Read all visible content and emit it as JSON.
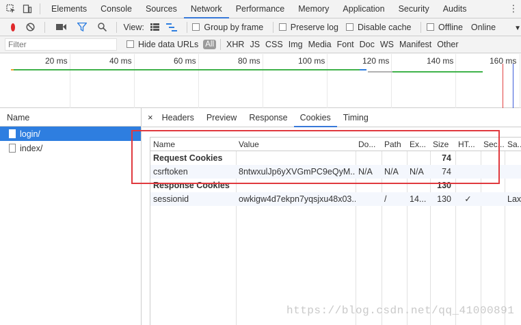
{
  "devtools_tabs": [
    "Elements",
    "Console",
    "Sources",
    "Network",
    "Performance",
    "Memory",
    "Application",
    "Security",
    "Audits"
  ],
  "active_tab": "Network",
  "toolbar": {
    "view_label": "View:",
    "group_by_frame": "Group by frame",
    "preserve_log": "Preserve log",
    "disable_cache": "Disable cache",
    "offline": "Offline",
    "throttle": "Online",
    "throttle_caret": "▼",
    "record_color": "#e0282b"
  },
  "filter": {
    "placeholder": "Filter",
    "hide_data_urls": "Hide data URLs",
    "all_label": "All",
    "types": [
      "XHR",
      "JS",
      "CSS",
      "Img",
      "Media",
      "Font",
      "Doc",
      "WS",
      "Manifest",
      "Other"
    ]
  },
  "timeline": {
    "ticks": [
      "20 ms",
      "40 ms",
      "60 ms",
      "80 ms",
      "100 ms",
      "120 ms",
      "140 ms",
      "160 ms"
    ]
  },
  "requests": {
    "header": "Name",
    "items": [
      {
        "name": "login/",
        "selected": true
      },
      {
        "name": "index/",
        "selected": false
      }
    ]
  },
  "detail_tabs": {
    "close": "×",
    "tabs": [
      "Headers",
      "Preview",
      "Response",
      "Cookies",
      "Timing"
    ],
    "active": "Cookies"
  },
  "cookies": {
    "columns": [
      "Name",
      "Value",
      "Do...",
      "Path",
      "Ex...",
      "Size",
      "HT...",
      "Sec...",
      "Sa..."
    ],
    "request_section": {
      "label": "Request Cookies",
      "size": "74"
    },
    "request_rows": [
      {
        "name": "csrftoken",
        "value": "8ntwxulJp6yXVGmPC9eQyM...",
        "domain": "N/A",
        "path": "N/A",
        "expires": "N/A",
        "size": "74",
        "httponly": "",
        "secure": "",
        "samesite": ""
      }
    ],
    "response_section": {
      "label": "Response Cookies",
      "size": "130"
    },
    "response_rows": [
      {
        "name": "sessionid",
        "value": "owkigw4d7ekpn7yqsjxu48x03...",
        "domain": "",
        "path": "/",
        "expires": "14...",
        "size": "130",
        "httponly": "✓",
        "secure": "",
        "samesite": "Lax"
      }
    ]
  },
  "watermark": "https://blog.csdn.net/qq_41000891",
  "colors": {
    "accent": "#3879d9",
    "selected_row": "#2e7ee0",
    "annotation": "#e0393e"
  }
}
